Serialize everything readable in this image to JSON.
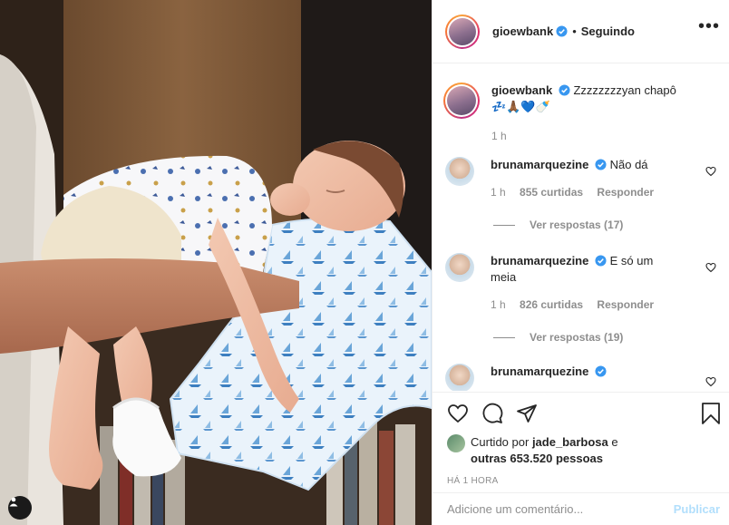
{
  "post": {
    "author": "gioewbank",
    "follow_sep": "•",
    "follow_label": "Seguindo",
    "more_label": "•••",
    "caption": "Zzzzzzzzyan chapô 💤🙏🏾💙🍼",
    "caption_time": "1 h"
  },
  "comments": [
    {
      "user": "brunamarquezine",
      "text": "Não dá",
      "time": "1 h",
      "likes": "855 curtidas",
      "reply": "Responder",
      "view_replies": "Ver respostas (17)"
    },
    {
      "user": "brunamarquezine",
      "text": "E só um meia",
      "time": "1 h",
      "likes": "826 curtidas",
      "reply": "Responder",
      "view_replies": "Ver respostas (19)"
    },
    {
      "user": "brunamarquezine",
      "text": ""
    }
  ],
  "likes": {
    "prefix": "Curtido por",
    "user": "jade_barbosa",
    "and": "e",
    "others": "outras 653.520 pessoas"
  },
  "posted_ago": "HÁ 1 HORA",
  "add_comment": {
    "placeholder": "Adicione um comentário...",
    "publish": "Publicar"
  },
  "icons": [
    "heart-icon",
    "comment-icon",
    "share-icon",
    "bookmark-icon",
    "user-tag-icon",
    "more-icon",
    "verified-icon"
  ],
  "colors": {
    "verified": "#3897f0",
    "publish": "#b2dffc",
    "muted": "#8e8e8e"
  }
}
